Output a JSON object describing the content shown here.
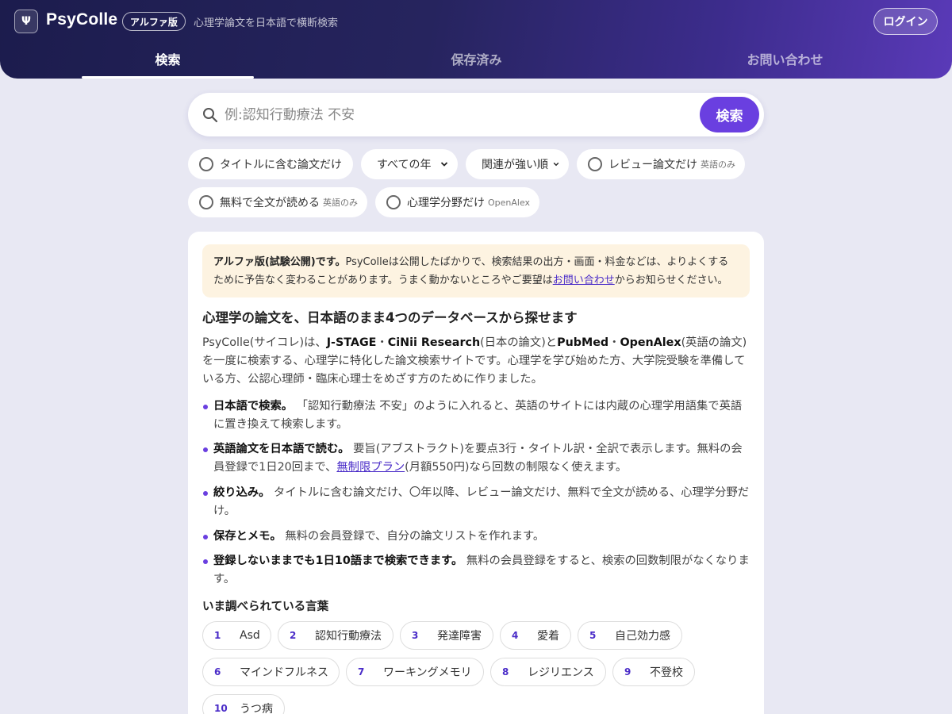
{
  "header": {
    "logo_glyph": "Ψ",
    "brand": "PsyColle",
    "badge": "アルファ版",
    "tagline": "心理学論文を日本語で横断検索",
    "login": "ログイン",
    "tabs": [
      {
        "label": "検索",
        "active": true
      },
      {
        "label": "保存済み",
        "active": false
      },
      {
        "label": "お問い合わせ",
        "active": false
      }
    ]
  },
  "search": {
    "placeholder": "例:認知行動療法 不安",
    "button": "検索"
  },
  "filters": {
    "title_only": "タイトルに含む論文だけ",
    "year_select": "すべての年",
    "sort_select": "関連が強い順",
    "review_only": "レビュー論文だけ",
    "review_note": "英語のみ",
    "free_fulltext": "無料で全文が読める",
    "free_note": "英語のみ",
    "psych_only": "心理学分野だけ",
    "psych_note": "OpenAlex"
  },
  "notice": {
    "bold": "アルファ版(試験公開)です。",
    "text_before_link": "PsyColleは公開したばかりで、検索結果の出方・画面・料金などは、よりよくするために予告なく変わることがあります。うまく動かないところやご要望は",
    "link": "お問い合わせ",
    "text_after_link": "からお知らせください。"
  },
  "intro": {
    "title": "心理学の論文を、日本語のまま4つのデータベースから探せます",
    "p1": "PsyColle(サイコレ)は、",
    "db1": "J-STAGE",
    "sep1": "・",
    "db2": "CiNii Research",
    "p2": "(日本の論文)と",
    "db3": "PubMed",
    "sep2": "・",
    "db4": "OpenAlex",
    "p3": "(英語の論文)を一度に検索する、心理学に特化した論文検索サイトです。心理学を学び始めた方、大学院受験を準備している方、公認心理師・臨床心理士をめざす方のために作りました。"
  },
  "features": [
    {
      "title": "日本語で検索。",
      "text": "「認知行動療法 不安」のように入れると、英語のサイトには内蔵の心理学用語集で英語に置き換えて検索します。"
    },
    {
      "title": "英語論文を日本語で読む。",
      "text_before_link": "要旨(アブストラクト)を要点3行・タイトル訳・全訳で表示します。無料の会員登録で1日20回まで、",
      "link": "無制限プラン",
      "text_after_link": "(月額550円)なら回数の制限なく使えます。"
    },
    {
      "title": "絞り込み。",
      "text": "タイトルに含む論文だけ、〇年以降、レビュー論文だけ、無料で全文が読める、心理学分野だけ。"
    },
    {
      "title": "保存とメモ。",
      "text": "無料の会員登録で、自分の論文リストを作れます。"
    },
    {
      "title": "登録しないままでも1日10語まで検索できます。",
      "text": "無料の会員登録をすると、検索の回数制限がなくなります。"
    }
  ],
  "trending": {
    "title": "いま調べられている言葉",
    "items": [
      {
        "rank": "1",
        "term": "Asd"
      },
      {
        "rank": "2",
        "term": "認知行動療法"
      },
      {
        "rank": "3",
        "term": "発達障害"
      },
      {
        "rank": "4",
        "term": "愛着"
      },
      {
        "rank": "5",
        "term": "自己効力感"
      },
      {
        "rank": "6",
        "term": "マインドフルネス"
      },
      {
        "rank": "7",
        "term": "ワーキングメモリ"
      },
      {
        "rank": "8",
        "term": "レジリエンス"
      },
      {
        "rank": "9",
        "term": "不登校"
      },
      {
        "rank": "10",
        "term": "うつ病"
      }
    ]
  },
  "colors": {
    "accent": "#6a3fe0",
    "header_dark": "#1c1c4d",
    "notice_bg": "#fdf3e1"
  }
}
